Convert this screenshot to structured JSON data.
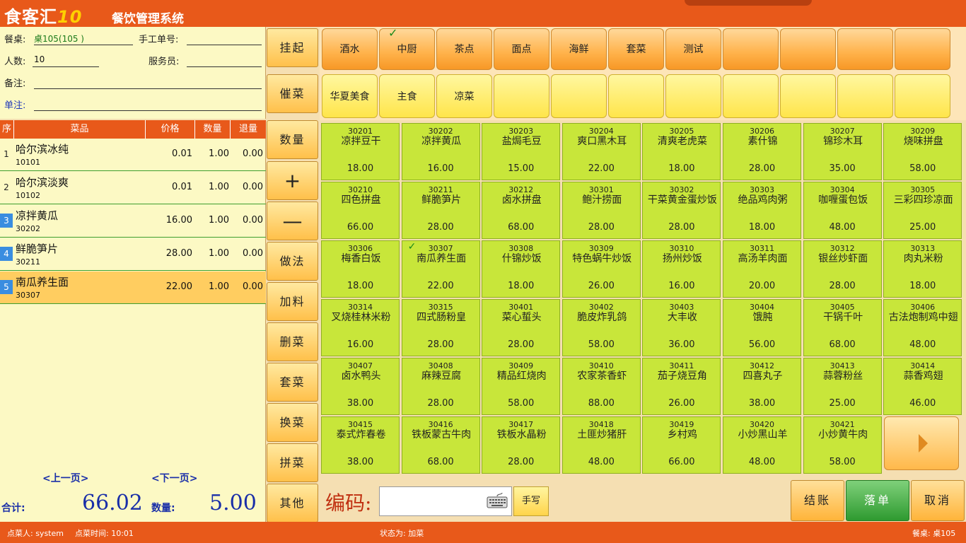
{
  "header": {
    "logo_main": "食客汇",
    "logo_num": "10",
    "title": "餐饮管理系统"
  },
  "info": {
    "table_label": "餐桌:",
    "table_value": "桌105(105 )",
    "manual_label": "手工单号:",
    "manual_value": "",
    "people_label": "人数:",
    "people_value": "10",
    "waiter_label": "服务员:",
    "waiter_value": "",
    "remark_label": "备注:",
    "remark_value": "",
    "order_note_label": "单注:",
    "order_note_value": ""
  },
  "order_table": {
    "headers": [
      "序",
      "菜品",
      "价格",
      "数量",
      "退量"
    ],
    "rows": [
      {
        "seq": "1",
        "name": "哈尔滨冰纯",
        "code": "10101",
        "price": "0.01",
        "qty": "1.00",
        "ret": "0.00"
      },
      {
        "seq": "2",
        "name": "哈尔滨淡爽",
        "code": "10102",
        "price": "0.01",
        "qty": "1.00",
        "ret": "0.00"
      },
      {
        "seq": "3",
        "name": "凉拌黄瓜",
        "code": "30202",
        "price": "16.00",
        "qty": "1.00",
        "ret": "0.00"
      },
      {
        "seq": "4",
        "name": "鲜脆笋片",
        "code": "30211",
        "price": "28.00",
        "qty": "1.00",
        "ret": "0.00"
      },
      {
        "seq": "5",
        "name": "南瓜养生面",
        "code": "30307",
        "price": "22.00",
        "qty": "1.00",
        "ret": "0.00"
      }
    ],
    "prev_page": "<上一页>",
    "next_page": "<下一页>"
  },
  "totals": {
    "total_label": "合计:",
    "total_value": "66.02",
    "qty_label": "数量:",
    "qty_value": "5.00"
  },
  "side_buttons": [
    "挂起",
    "催菜",
    "数量",
    "+",
    "—",
    "做法",
    "加料",
    "删菜",
    "套菜",
    "换菜",
    "拼菜",
    "其他"
  ],
  "categories": [
    "酒水",
    "中厨",
    "茶点",
    "面点",
    "海鲜",
    "套菜",
    "测试",
    "",
    "",
    "",
    ""
  ],
  "subcategories": [
    "华夏美食",
    "主食",
    "凉菜",
    "",
    "",
    "",
    "",
    "",
    "",
    "",
    ""
  ],
  "dishes": [
    {
      "code": "30201",
      "name": "凉拌豆干",
      "price": "18.00"
    },
    {
      "code": "30202",
      "name": "凉拌黄瓜",
      "price": "16.00"
    },
    {
      "code": "30203",
      "name": "盐焗毛豆",
      "price": "15.00"
    },
    {
      "code": "30204",
      "name": "爽口黑木耳",
      "price": "22.00"
    },
    {
      "code": "30205",
      "name": "清爽老虎菜",
      "price": "18.00"
    },
    {
      "code": "30206",
      "name": "素什锦",
      "price": "28.00"
    },
    {
      "code": "30207",
      "name": "锦珍木耳",
      "price": "35.00"
    },
    {
      "code": "30209",
      "name": "烧味拼盘",
      "price": "58.00"
    },
    {
      "code": "30210",
      "name": "四色拼盘",
      "price": "66.00"
    },
    {
      "code": "30211",
      "name": "鲜脆笋片",
      "price": "28.00"
    },
    {
      "code": "30212",
      "name": "卤水拼盘",
      "price": "68.00"
    },
    {
      "code": "30301",
      "name": "鲍汁捞面",
      "price": "28.00"
    },
    {
      "code": "30302",
      "name": "干菜黄金蛋炒饭",
      "price": "28.00"
    },
    {
      "code": "30303",
      "name": "绝品鸡肉粥",
      "price": "18.00"
    },
    {
      "code": "30304",
      "name": "咖喱蛋包饭",
      "price": "48.00"
    },
    {
      "code": "30305",
      "name": "三彩四珍凉面",
      "price": "25.00"
    },
    {
      "code": "30306",
      "name": "梅香白饭",
      "price": "18.00"
    },
    {
      "code": "30307",
      "name": "南瓜养生面",
      "price": "22.00"
    },
    {
      "code": "30308",
      "name": "什锦炒饭",
      "price": "18.00"
    },
    {
      "code": "30309",
      "name": "特色蜗牛炒饭",
      "price": "26.00"
    },
    {
      "code": "30310",
      "name": "扬州炒饭",
      "price": "16.00"
    },
    {
      "code": "30311",
      "name": "高汤羊肉面",
      "price": "20.00"
    },
    {
      "code": "30312",
      "name": "银丝炒虾面",
      "price": "28.00"
    },
    {
      "code": "30313",
      "name": "肉丸米粉",
      "price": "18.00"
    },
    {
      "code": "30314",
      "name": "叉烧桂林米粉",
      "price": "16.00"
    },
    {
      "code": "30315",
      "name": "四式肠粉皇",
      "price": "28.00"
    },
    {
      "code": "30401",
      "name": "菜心蜇头",
      "price": "28.00"
    },
    {
      "code": "30402",
      "name": "脆皮炸乳鸽",
      "price": "58.00"
    },
    {
      "code": "30403",
      "name": "大丰收",
      "price": "36.00"
    },
    {
      "code": "30404",
      "name": "饿肫",
      "price": "56.00"
    },
    {
      "code": "30405",
      "name": "干锅千叶",
      "price": "68.00"
    },
    {
      "code": "30406",
      "name": "古法炮制鸡中翅",
      "price": "48.00"
    },
    {
      "code": "30407",
      "name": "卤水鸭头",
      "price": "38.00"
    },
    {
      "code": "30408",
      "name": "麻辣豆腐",
      "price": "28.00"
    },
    {
      "code": "30409",
      "name": "精品红烧肉",
      "price": "58.00"
    },
    {
      "code": "30410",
      "name": "农家茶香虾",
      "price": "88.00"
    },
    {
      "code": "30411",
      "name": "茄子烧豆角",
      "price": "26.00"
    },
    {
      "code": "30412",
      "name": "四喜丸子",
      "price": "38.00"
    },
    {
      "code": "30413",
      "name": "蒜蓉粉丝",
      "price": "25.00"
    },
    {
      "code": "30414",
      "name": "蒜香鸡翅",
      "price": "46.00"
    },
    {
      "code": "30415",
      "name": "泰式炸春卷",
      "price": "38.00"
    },
    {
      "code": "30416",
      "name": "铁板蒙古牛肉",
      "price": "68.00"
    },
    {
      "code": "30417",
      "name": "铁板水晶粉",
      "price": "28.00"
    },
    {
      "code": "30418",
      "name": "土匪炒猪肝",
      "price": "48.00"
    },
    {
      "code": "30419",
      "name": "乡村鸡",
      "price": "66.00"
    },
    {
      "code": "30420",
      "name": "小炒黑山羊",
      "price": "48.00"
    },
    {
      "code": "30421",
      "name": "小炒黄牛肉",
      "price": "58.00"
    }
  ],
  "bottom": {
    "code_label": "编码:",
    "code_value": "",
    "handwrite": "手写",
    "checkout": "结账",
    "submit": "落单",
    "cancel": "取消"
  },
  "status": {
    "user": "点菜人: system",
    "time": "点菜时间: 10:01",
    "state": "状态为: 加菜",
    "table": "餐桌: 桌105"
  }
}
